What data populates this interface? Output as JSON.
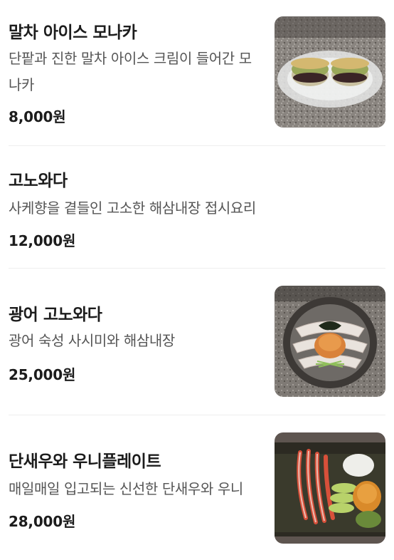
{
  "menu": {
    "items": [
      {
        "name": "말차 아이스 모나카",
        "description": "단팥과 진한 말차 아이스 크림이 들어간 모나카",
        "price": "8,000원",
        "photo": "matcha-ice-monaka-photo"
      },
      {
        "name": "고노와다",
        "description": "사케향을 곁들인 고소한 해삼내장 접시요리",
        "price": "12,000원",
        "photo": null
      },
      {
        "name": "광어 고노와다",
        "description": "광어 숙성 사시미와 해삼내장",
        "price": "25,000원",
        "photo": "flounder-konowata-photo"
      },
      {
        "name": "단새우와 우니플레이트",
        "description": "매일매일 입고되는 신선한 단새우와 우니",
        "price": "28,000원",
        "photo": "sweet-shrimp-uni-plate-photo"
      }
    ]
  }
}
